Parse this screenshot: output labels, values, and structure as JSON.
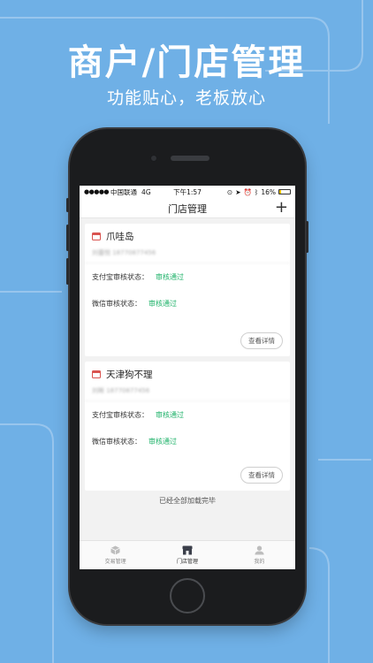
{
  "promo": {
    "headline": "商户/门店管理",
    "subline": "功能贴心，老板放心"
  },
  "status_bar": {
    "signal": "●●●●●",
    "carrier": "中国联通",
    "network": "4G",
    "time": "下午1:57",
    "battery": "16%",
    "battery_level": 0.16
  },
  "nav": {
    "title": "门店管理",
    "add_label": "+"
  },
  "stores": [
    {
      "name": "爪哇岛",
      "contact": "刘蕾悦  18770877456",
      "alipay_label": "支付宝审核状态：",
      "alipay_status": "审核通过",
      "wechat_label": "微信审核状态：",
      "wechat_status": "审核通过",
      "detail_label": "查看详情"
    },
    {
      "name": "天津狗不理",
      "contact": "刘晰  18770877456",
      "alipay_label": "支付宝审核状态：",
      "alipay_status": "审核通过",
      "wechat_label": "微信审核状态：",
      "wechat_status": "审核通过",
      "detail_label": "查看详情"
    }
  ],
  "loaded_text": "已经全部加载完毕",
  "tabs": [
    {
      "label": "交易管理",
      "icon": "cube-icon"
    },
    {
      "label": "门店管理",
      "icon": "store-icon"
    },
    {
      "label": "我的",
      "icon": "user-icon"
    }
  ],
  "colors": {
    "background": "#6fb0e6",
    "approved_green": "#21b36b",
    "store_icon_red": "#d9534f"
  }
}
